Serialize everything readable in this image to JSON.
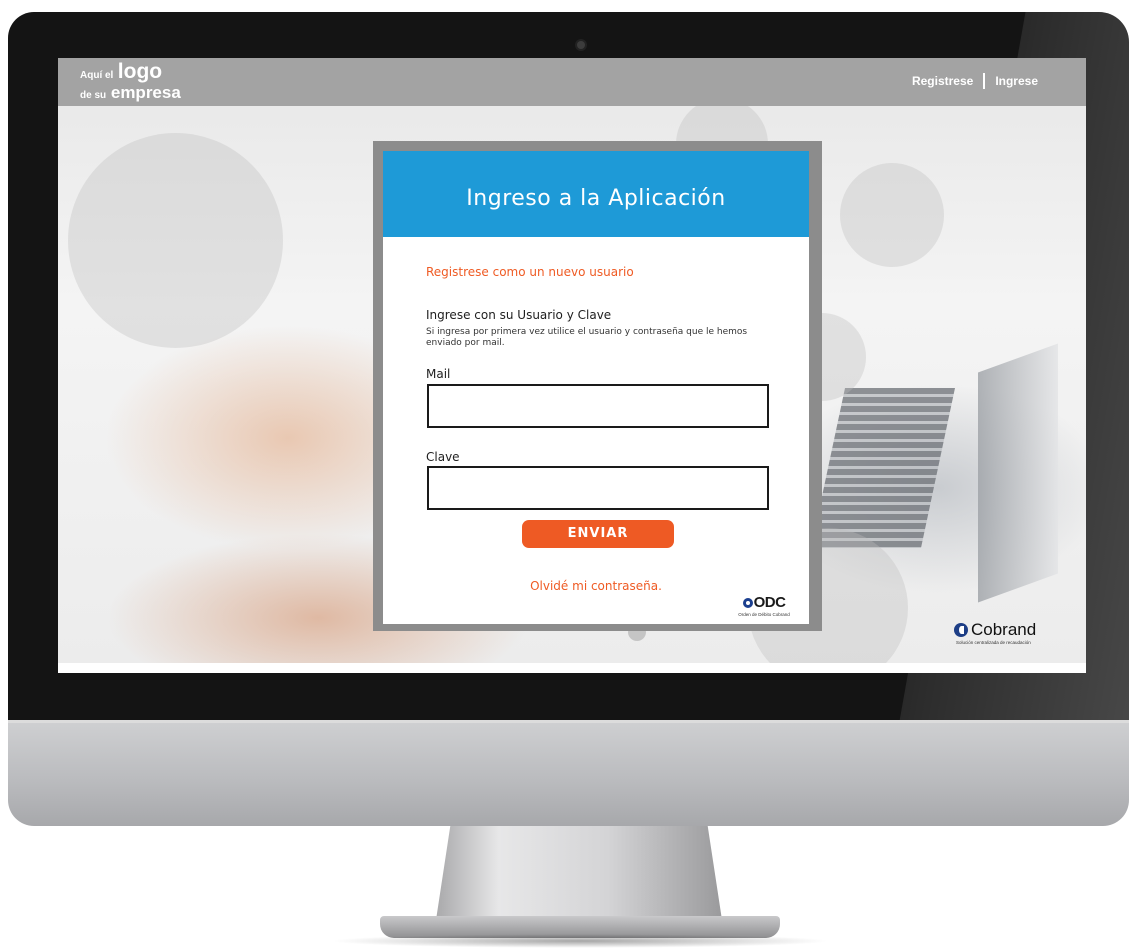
{
  "header": {
    "logo": {
      "line1_small": "Aquí el",
      "line1_big": "logo",
      "line2_small": "de su",
      "line2_big": "empresa"
    },
    "nav": {
      "register": "Registrese",
      "login": "Ingrese"
    }
  },
  "login_card": {
    "title": "Ingreso a la Aplicación",
    "register_link": "Registrese como un nuevo usuario",
    "subtitle": "Ingrese con su Usuario y Clave",
    "hint": "Si ingresa por primera vez utilice el usuario y contraseña que le hemos enviado por mail.",
    "mail_label": "Mail",
    "mail_value": "",
    "password_label": "Clave",
    "password_value": "",
    "submit_label": "ENVIAR",
    "forgot_link": "Olvidé mi contraseña.",
    "odc_logo": {
      "mark": "ODC",
      "caption": "Orden de Débito Cobrand"
    }
  },
  "footer_brand": {
    "name": "Cobrand",
    "caption": "Solución centralizada de recaudación"
  },
  "colors": {
    "accent_orange": "#ee5a24",
    "header_blue": "#1e9ad7",
    "topbar_gray": "#a3a3a3"
  }
}
